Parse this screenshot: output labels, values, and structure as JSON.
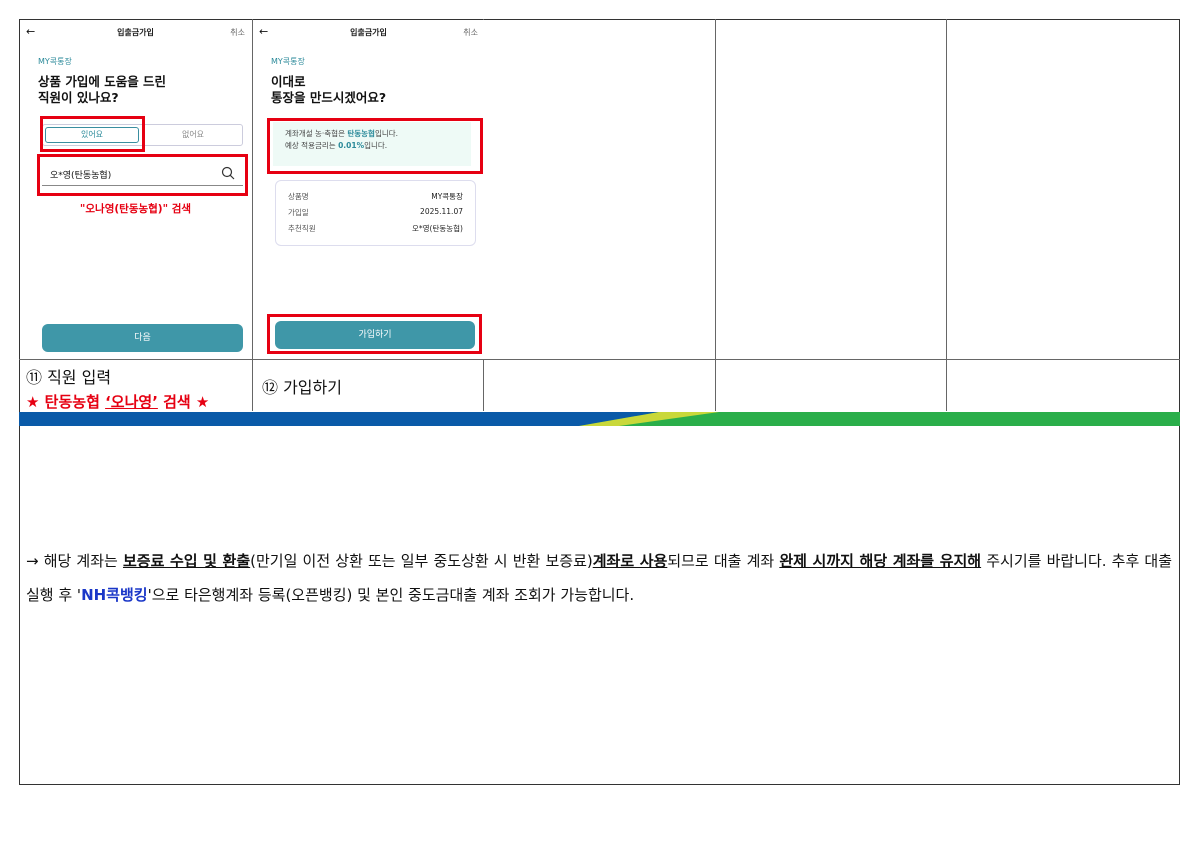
{
  "screen1": {
    "back": "←",
    "title": "입출금가입",
    "cancel": "취소",
    "tag": "MY콕통장",
    "heading_line1": "상품 가입에 도움을 드린",
    "heading_line2": "직원이 있나요?",
    "yes": "있어요",
    "no": "없어요",
    "search_value": "오*영(탄동농협)",
    "search_note": "\"오나영(탄동농협)\" 검색",
    "next": "다음"
  },
  "screen2": {
    "back": "←",
    "title": "입출금가입",
    "cancel": "취소",
    "tag": "MY콕통장",
    "heading_line1": "이대로",
    "heading_line2": "통장을 만드시겠어요?",
    "info_line1_pre": "계좌개설 농·축협은 ",
    "info_line1_hl": "탄동농협",
    "info_line1_post": "입니다.",
    "info_line2_pre": "예상 적용금리는 ",
    "info_line2_hl": "0.01%",
    "info_line2_post": "입니다.",
    "rows": [
      {
        "k": "상품명",
        "v": "MY콕통장"
      },
      {
        "k": "가입일",
        "v": "2025.11.07"
      },
      {
        "k": "추천직원",
        "v": "오*영(탄동농협)"
      }
    ],
    "join": "가입하기"
  },
  "captions": {
    "step11": "⑪ 직원 입력",
    "step11_star_pre": "★ 탄동농협 ",
    "step11_star_name": "‘오나영’",
    "step11_star_post": " 검색 ★",
    "step12": "⑫ 가입하기"
  },
  "body": {
    "t1": "→ 해당 계좌는 ",
    "t2": "보증료 수입 및 환출",
    "t3": "(만기일 이전 상환 또는 일부 중도상환 시 반환 보증료)",
    "t4": "계좌로 사용",
    "t5": "되므로 대출 계좌 ",
    "t6": "완제 시까지 해당 계좌를 유지해",
    "t7": " 주시기를 바랍니다. 추후 대출 실행 후 '",
    "t8": "NH콕뱅킹",
    "t9": "'으로 타은행계좌 등록(오픈뱅킹) 및 본인 중도금대출 계좌 조회가 가능합니다."
  },
  "colors": {
    "accent_teal": "#3f97a8",
    "highlight_red": "#e60012",
    "nh_blue": "#1a37c8",
    "band_blue": "#0a5aa8",
    "band_green": "#2aae4a"
  }
}
